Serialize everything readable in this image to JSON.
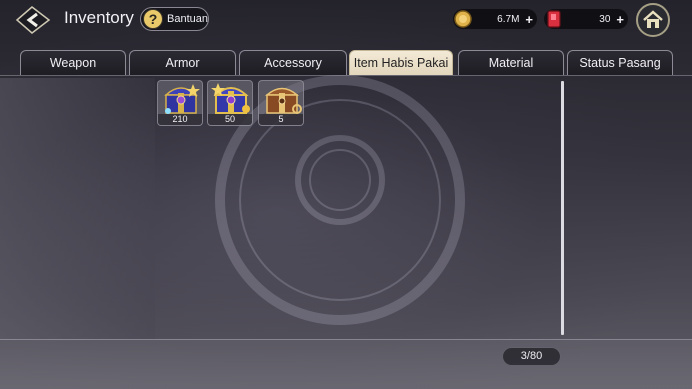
{
  "header": {
    "title": "Inventory",
    "help_label": "Bantuan",
    "gold_amount": "6.7M",
    "gem_amount": "30"
  },
  "tabs": [
    {
      "label": "Weapon",
      "active": false
    },
    {
      "label": "Armor",
      "active": false
    },
    {
      "label": "Accessory",
      "active": false
    },
    {
      "label": "Item Habis Pakai",
      "active": true
    },
    {
      "label": "Material",
      "active": false
    },
    {
      "label": "Status Pasang",
      "active": false
    }
  ],
  "items": [
    {
      "icon": "blue-star-chest-icon",
      "quantity": "210"
    },
    {
      "icon": "blue-gold-chest-icon",
      "quantity": "50"
    },
    {
      "icon": "wooden-chest-icon",
      "quantity": "5"
    }
  ],
  "footer": {
    "capacity": "3/80"
  },
  "colors": {
    "active_tab": "#ece2cb",
    "gold": "#e0b34a",
    "gem": "#d93040"
  }
}
